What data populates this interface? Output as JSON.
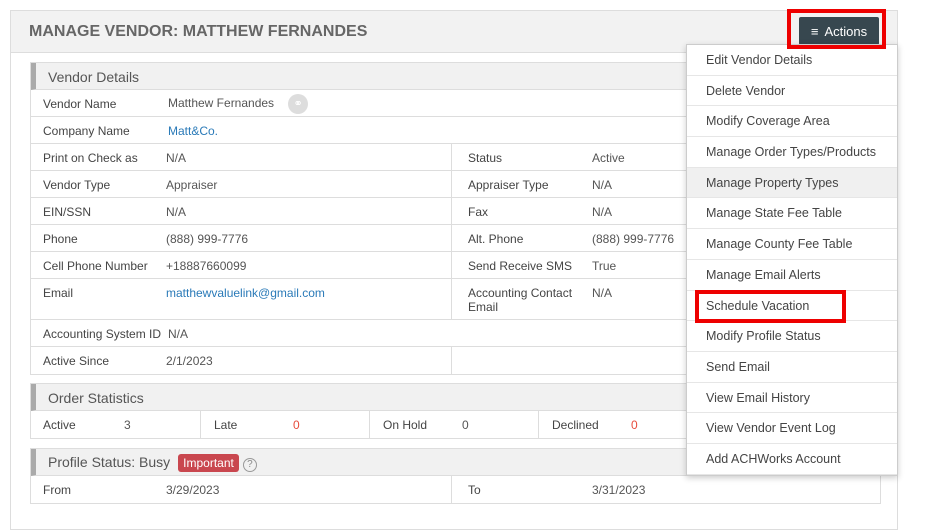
{
  "title": "MANAGE VENDOR: MATTHEW FERNANDES",
  "actions_label": "Actions",
  "vendor_details": {
    "heading": "Vendor Details",
    "vendor_name_label": "Vendor Name",
    "vendor_name": "Matthew Fernandes",
    "company_label": "Company Name",
    "company": "Matt&Co.",
    "print_label": "Print on Check as",
    "print": "N/A",
    "status_label": "Status",
    "status": "Active",
    "type_label": "Vendor Type",
    "type": "Appraiser",
    "appraiser_type_label": "Appraiser Type",
    "appraiser_type": "N/A",
    "ein_label": "EIN/SSN",
    "ein": "N/A",
    "fax_label": "Fax",
    "fax": "N/A",
    "phone_label": "Phone",
    "phone": "(888) 999-7776",
    "alt_phone_label": "Alt. Phone",
    "alt_phone": "(888) 999-7776",
    "cell_label": "Cell Phone Number",
    "cell": "+18887660099",
    "sms_label": "Send Receive SMS",
    "sms": "True",
    "email_label": "Email",
    "email": "matthewvaluelink@gmail.com",
    "acct_email_label": "Accounting Contact Email",
    "acct_email": "N/A",
    "acct_sys_label": "Accounting System ID",
    "acct_sys": "N/A",
    "since_label": "Active Since",
    "since": "2/1/2023"
  },
  "order_stats": {
    "heading": "Order Statistics",
    "items": [
      {
        "label": "Active",
        "value": "3"
      },
      {
        "label": "Late",
        "value": "0"
      },
      {
        "label": "On Hold",
        "value": "0"
      },
      {
        "label": "Declined",
        "value": "0"
      }
    ]
  },
  "profile_status": {
    "heading": "Profile Status: Busy",
    "badge": "Important",
    "help": "?",
    "from_label": "From",
    "from": "3/29/2023",
    "to_label": "To",
    "to": "3/31/2023"
  },
  "menu": [
    "Edit Vendor Details",
    "Delete Vendor",
    "Modify Coverage Area",
    "Manage Order Types/Products",
    "Manage Property Types",
    "Manage State Fee Table",
    "Manage County Fee Table",
    "Manage Email Alerts",
    "Schedule Vacation",
    "Modify Profile Status",
    "Send Email",
    "View Email History",
    "View Vendor Event Log",
    "Add ACHWorks Account"
  ]
}
